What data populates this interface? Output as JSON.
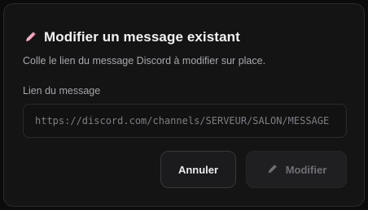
{
  "dialog": {
    "title": "Modifier un message existant",
    "title_icon": "pencil-icon",
    "description": "Colle le lien du message Discord à modifier sur place.",
    "field": {
      "label": "Lien du message",
      "placeholder": "https://discord.com/channels/SERVEUR/SALON/MESSAGE",
      "value": ""
    },
    "buttons": {
      "cancel_label": "Annuler",
      "modify_label": "Modifier",
      "modify_icon": "pencil-icon",
      "modify_enabled": false
    }
  },
  "colors": {
    "accent_icon": "#f3a8c0",
    "background": "#141415",
    "text_primary": "#f2f2f3",
    "text_muted": "#a9a9ae",
    "disabled_text": "#6f6f75"
  }
}
